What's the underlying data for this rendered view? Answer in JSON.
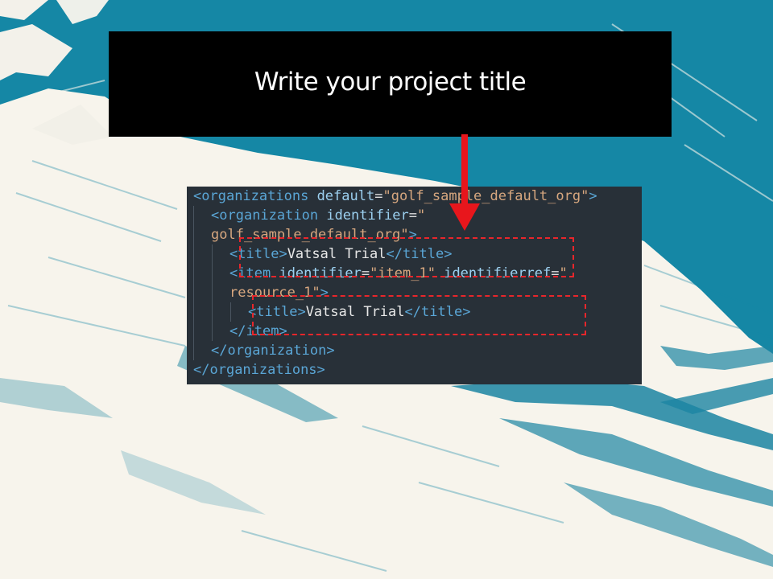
{
  "slide": {
    "title": "Write your project title",
    "colors": {
      "teal": "#1587a5",
      "white": "#ffffff",
      "title_bg": "#000000",
      "arrow": "#e8161c",
      "code_bg": "#283038"
    }
  },
  "code": {
    "l1_open": "<",
    "l1_tag": "organizations",
    "l1_attr": "default",
    "l1_eq": "=",
    "l1_val": "\"golf_sample_default_org\"",
    "l1_close": ">",
    "l2_open": "<",
    "l2_tag": "organization",
    "l2_attr": "identifier",
    "l2_eq": "=",
    "l2_val": "\"",
    "l3_val": "golf_sample_default_org\"",
    "l3_close": ">",
    "l4_open": "<",
    "l4_tag": "title",
    "l4_close": ">",
    "l4_text": "Vatsal Trial",
    "l4_end_open": "</",
    "l4_end_tag": "title",
    "l4_end_close": ">",
    "l5_open": "<",
    "l5_tag": "item",
    "l5_attr1": "identifier",
    "l5_eq1": "=",
    "l5_val1": "\"item_1\"",
    "l5_attr2": "identifierref",
    "l5_eq2": "=",
    "l5_val2": "\"",
    "l6_val": "resource_1\"",
    "l6_close": ">",
    "l7_open": "<",
    "l7_tag": "title",
    "l7_close": ">",
    "l7_text": "Vatsal Trial",
    "l7_end_open": "</",
    "l7_end_tag": "title",
    "l7_end_close": ">",
    "l8_open": "</",
    "l8_tag": "item",
    "l8_close": ">",
    "l9_open": "</",
    "l9_tag": "organization",
    "l9_close": ">",
    "l10_open": "</",
    "l10_tag": "organizations",
    "l10_close": ">"
  }
}
